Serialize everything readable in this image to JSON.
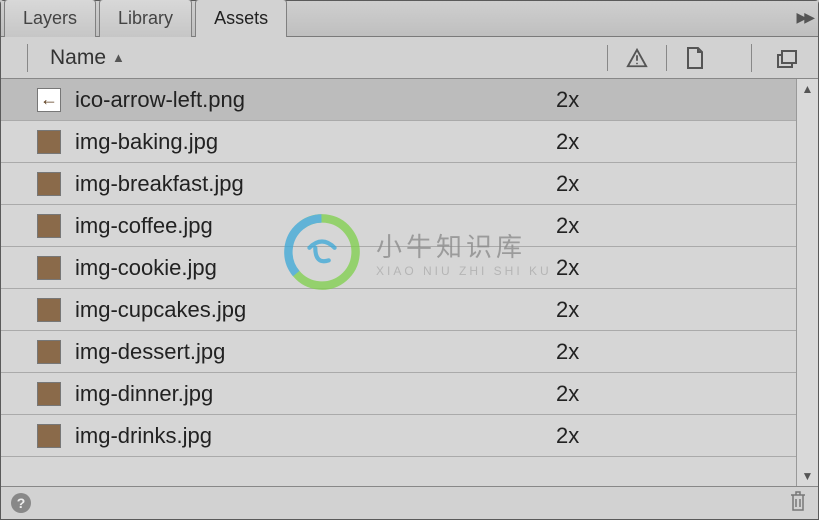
{
  "tabs": [
    {
      "label": "Layers",
      "active": false
    },
    {
      "label": "Library",
      "active": false
    },
    {
      "label": "Assets",
      "active": true
    }
  ],
  "columns": {
    "name_label": "Name",
    "scale_header_icons": [
      "warning",
      "page",
      "stack"
    ]
  },
  "assets": [
    {
      "name": "ico-arrow-left.png",
      "scale": "2x",
      "selected": true,
      "thumb": "arrow"
    },
    {
      "name": "img-baking.jpg",
      "scale": "2x",
      "selected": false,
      "thumb": "photo"
    },
    {
      "name": "img-breakfast.jpg",
      "scale": "2x",
      "selected": false,
      "thumb": "photo"
    },
    {
      "name": "img-coffee.jpg",
      "scale": "2x",
      "selected": false,
      "thumb": "photo"
    },
    {
      "name": "img-cookie.jpg",
      "scale": "2x",
      "selected": false,
      "thumb": "photo"
    },
    {
      "name": "img-cupcakes.jpg",
      "scale": "2x",
      "selected": false,
      "thumb": "photo"
    },
    {
      "name": "img-dessert.jpg",
      "scale": "2x",
      "selected": false,
      "thumb": "photo"
    },
    {
      "name": "img-dinner.jpg",
      "scale": "2x",
      "selected": false,
      "thumb": "photo"
    },
    {
      "name": "img-drinks.jpg",
      "scale": "2x",
      "selected": false,
      "thumb": "photo"
    }
  ],
  "watermark": {
    "main": "小牛知识库",
    "sub": "XIAO NIU ZHI SHI KU"
  }
}
